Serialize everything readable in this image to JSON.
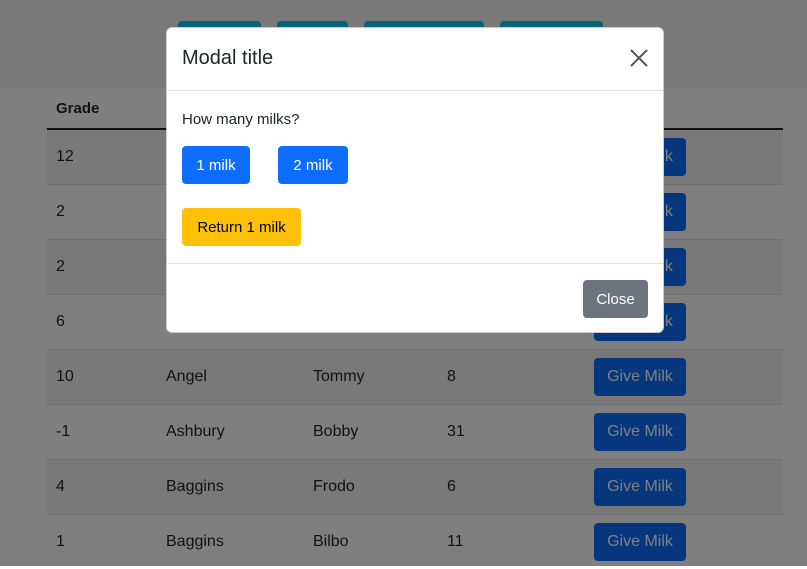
{
  "table": {
    "headers": [
      "Grade",
      "",
      "",
      "",
      ""
    ],
    "rows": [
      {
        "grade": "12",
        "last": "",
        "first": "",
        "age": "",
        "action": "Give Milk"
      },
      {
        "grade": "2",
        "last": "",
        "first": "",
        "age": "",
        "action": "Give Milk"
      },
      {
        "grade": "2",
        "last": "",
        "first": "",
        "age": "",
        "action": "Give Milk"
      },
      {
        "grade": "6",
        "last": "",
        "first": "",
        "age": "",
        "action": "Give Milk"
      },
      {
        "grade": "10",
        "last": "Angel",
        "first": "Tommy",
        "age": "8",
        "action": "Give Milk"
      },
      {
        "grade": "-1",
        "last": "Ashbury",
        "first": "Bobby",
        "age": "31",
        "action": "Give Milk"
      },
      {
        "grade": "4",
        "last": "Baggins",
        "first": "Frodo",
        "age": "6",
        "action": "Give Milk"
      },
      {
        "grade": "1",
        "last": "Baggins",
        "first": "Bilbo",
        "age": "11",
        "action": "Give Milk"
      }
    ]
  },
  "modal": {
    "title": "Modal title",
    "question": "How many milks?",
    "btn_one": "1 milk",
    "btn_two": "2 milk",
    "btn_return": "Return 1 milk",
    "btn_close": "Close",
    "close_icon": "close-icon"
  },
  "colors": {
    "primary": "#0d6efd",
    "warning": "#ffc107",
    "secondary": "#6c757d",
    "top_buttons": "#0dcaf0"
  }
}
